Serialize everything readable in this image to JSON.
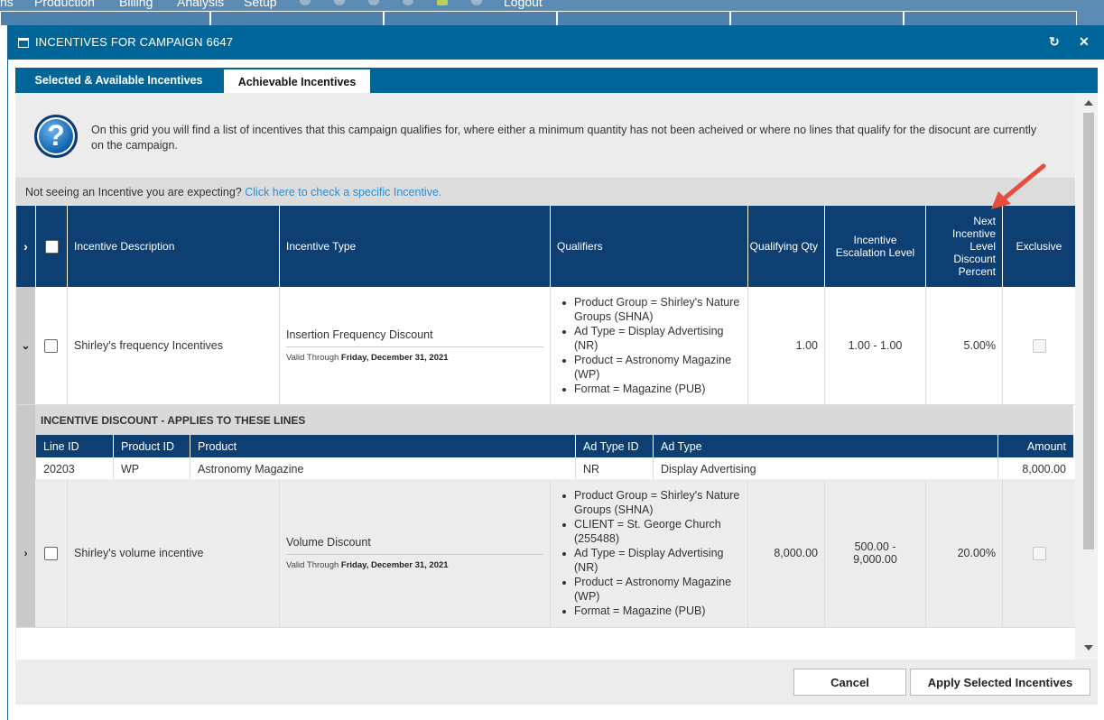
{
  "topnav": {
    "items": [
      "ns",
      "Production",
      "Billing",
      "Analysis",
      "Setup",
      "Logout"
    ]
  },
  "dialog": {
    "title": "INCENTIVES FOR CAMPAIGN 6647",
    "refresh_icon": "↻",
    "close_icon": "✕"
  },
  "tabs": [
    {
      "label": "Selected & Available Incentives",
      "active": false
    },
    {
      "label": "Achievable Incentives",
      "active": true
    }
  ],
  "info": {
    "icon": "?",
    "text": "On this grid you will find a list of incentives that this campaign qualifies for, where either a minimum quantity has not been acheived or where no lines that qualify for the disocunt are currently on the campaign."
  },
  "not_seeing": {
    "prefix": "Not seeing an Incentive you are expecting?",
    "link": "Click here to check a specific Incentive."
  },
  "grid": {
    "headers": {
      "expand": "›",
      "description": "Incentive Description",
      "type": "Incentive Type",
      "qualifiers": "Qualifiers",
      "qty": "Qualifying Qty",
      "level": "Incentive Escalation Level",
      "next": "Next Incentive Level Discount Percent",
      "exclusive": "Exclusive"
    },
    "rows": [
      {
        "expander": "⌄",
        "description": "Shirley's frequency Incentives",
        "type": "Insertion Frequency Discount",
        "valid_label": "Valid Through",
        "valid_date": "Friday, December 31, 2021",
        "qualifiers": [
          "Product Group = Shirley's Nature Groups (SHNA)",
          "Ad Type = Display Advertising (NR)",
          "Product = Astronomy Magazine (WP)",
          "Format = Magazine (PUB)"
        ],
        "qty": "1.00",
        "level": "1.00 - 1.00",
        "next": "5.00%"
      },
      {
        "expander": "›",
        "description": "Shirley's volume incentive",
        "type": "Volume Discount",
        "valid_label": "Valid Through",
        "valid_date": "Friday, December 31, 2021",
        "qualifiers": [
          "Product Group = Shirley's Nature Groups (SHNA)",
          "CLIENT = St. George Church (255488)",
          "Ad Type = Display Advertising (NR)",
          "Product = Astronomy Magazine (WP)",
          "Format = Magazine (PUB)"
        ],
        "qty": "8,000.00",
        "level": "500.00 - 9,000.00",
        "next": "20.00%"
      }
    ],
    "sub": {
      "title": "INCENTIVE DISCOUNT - APPLIES TO THESE LINES",
      "headers": {
        "line_id": "Line ID",
        "product_id": "Product ID",
        "product": "Product",
        "ad_type_id": "Ad Type ID",
        "ad_type": "Ad Type",
        "amount": "Amount"
      },
      "row": {
        "line_id": "20203",
        "product_id": "WP",
        "product": "Astronomy Magazine",
        "ad_type_id": "NR",
        "ad_type": "Display Advertising",
        "amount": "8,000.00"
      }
    }
  },
  "footer": {
    "cancel": "Cancel",
    "apply": "Apply Selected Incentives"
  },
  "colors": {
    "brand": "#00669a",
    "header": "#0d3f73",
    "link": "#2a8fd6",
    "annotation_arrow": "#e74c3c"
  }
}
